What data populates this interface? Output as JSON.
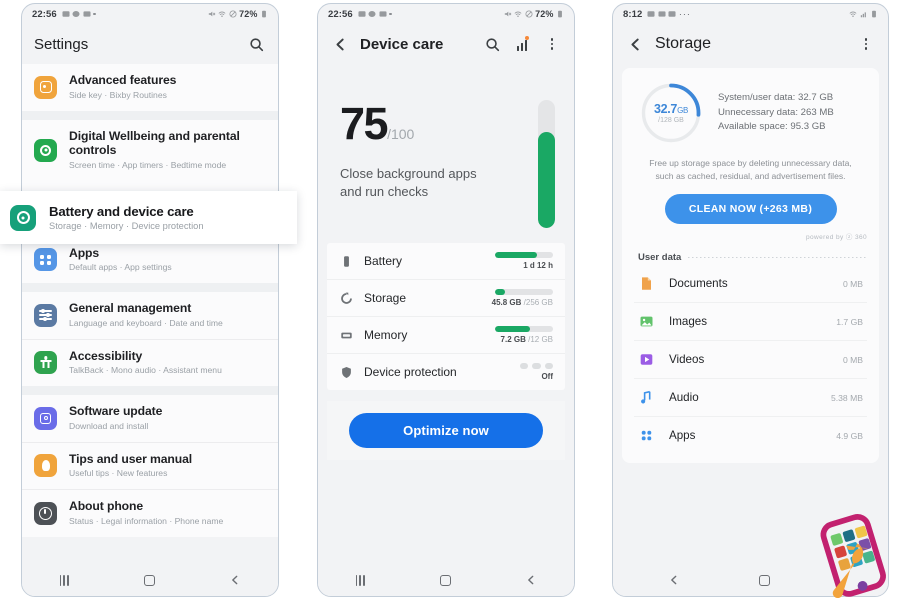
{
  "phone1": {
    "statusbar": {
      "time": "22:56",
      "battery_percent": "72%"
    },
    "appbar": {
      "title": "Settings",
      "search_icon": "search-icon"
    },
    "items": [
      {
        "title": "Advanced features",
        "subtitle": "Side key  ·  Bixby Routines",
        "icon": "advanced-features-icon",
        "color": "#f0a43c"
      },
      {
        "title": "Digital Wellbeing and parental controls",
        "subtitle": "Screen time  ·  App timers  ·  Bedtime mode",
        "icon": "digital-wellbeing-icon",
        "color": "#23a94f"
      },
      {
        "title": "Apps",
        "subtitle": "Default apps  ·  App settings",
        "icon": "apps-icon",
        "color": "#5596e6"
      },
      {
        "title": "General management",
        "subtitle": "Language and keyboard  ·  Date and time",
        "icon": "general-management-icon",
        "color": "#5b7aa3"
      },
      {
        "title": "Accessibility",
        "subtitle": "TalkBack  ·  Mono audio  ·  Assistant menu",
        "icon": "accessibility-icon",
        "color": "#2fa34f"
      },
      {
        "title": "Software update",
        "subtitle": "Download and install",
        "icon": "software-update-icon",
        "color": "#6a6ce8"
      },
      {
        "title": "Tips and user manual",
        "subtitle": "Useful tips  ·  New features",
        "icon": "tips-icon",
        "color": "#f0a43c"
      },
      {
        "title": "About phone",
        "subtitle": "Status  ·  Legal information  ·  Phone name",
        "icon": "about-phone-icon",
        "color": "#4d5156"
      }
    ],
    "highlighted": {
      "title": "Battery and device care",
      "subtitle": "Storage  ·  Memory  ·  Device protection",
      "icon": "battery-device-care-icon",
      "color": "#16a07a"
    },
    "nav": {
      "recents": "recents-icon",
      "home": "home-icon",
      "back": "back-icon"
    }
  },
  "phone2": {
    "statusbar": {
      "time": "22:56",
      "battery_percent": "72%"
    },
    "appbar": {
      "title": "Device care",
      "back_icon": "back-icon",
      "search_icon": "search-icon",
      "chart_icon": "bar-chart-icon",
      "menu_icon": "overflow-menu-icon"
    },
    "hero": {
      "score": "75",
      "score_max": "/100",
      "message_line1": "Close background apps",
      "message_line2": "and run checks",
      "gauge_percent": 75,
      "gauge_color": "#1aa864"
    },
    "rows": [
      {
        "label": "Battery",
        "icon": "battery-icon",
        "bar_percent": 72,
        "value": "1 d 12 h",
        "value_total": ""
      },
      {
        "label": "Storage",
        "icon": "storage-icon",
        "bar_percent": 18,
        "value": "45.8 GB ",
        "value_total": "/256 GB"
      },
      {
        "label": "Memory",
        "icon": "memory-icon",
        "bar_percent": 60,
        "value": "7.2 GB ",
        "value_total": "/12 GB"
      },
      {
        "label": "Device protection",
        "icon": "shield-icon",
        "bar_percent": 0,
        "value": "Off",
        "value_total": ""
      }
    ],
    "cta": {
      "label": "Optimize now",
      "color": "#1570e8"
    },
    "nav": {
      "recents": "recents-icon",
      "home": "home-icon",
      "back": "back-icon"
    }
  },
  "phone3": {
    "statusbar": {
      "time": "8:12"
    },
    "appbar": {
      "title": "Storage",
      "back_icon": "back-icon",
      "menu_icon": "overflow-menu-icon"
    },
    "ring": {
      "used": "32.7",
      "unit": "GB",
      "total": "/128 GB",
      "percent": 26,
      "color": "#3d87d8"
    },
    "details": [
      "System/user data: 32.7 GB",
      "Unnecessary data: 263 MB",
      "Available space: 95.3 GB"
    ],
    "note": "Free up storage space by deleting unnecessary data, such as cached, residual, and advertisement files.",
    "clean_button": {
      "label": "CLEAN NOW (+263 MB)",
      "color": "#3d92ea"
    },
    "powered_by": "powered by  ⓩ 360",
    "user_data_label": "User data",
    "files": [
      {
        "name": "Documents",
        "size": "0 MB",
        "icon": "document-icon",
        "color": "#f0a24b"
      },
      {
        "name": "Images",
        "size": "1.7 GB",
        "icon": "image-icon",
        "color": "#62c36c"
      },
      {
        "name": "Videos",
        "size": "0 MB",
        "icon": "video-icon",
        "color": "#9b5de5"
      },
      {
        "name": "Audio",
        "size": "5.38 MB",
        "icon": "audio-icon",
        "color": "#3d92ea"
      },
      {
        "name": "Apps",
        "size": "4.9 GB",
        "icon": "apps-grid-icon",
        "color": "#3d92ea"
      }
    ],
    "nav": {
      "back": "back-icon",
      "home": "home-icon"
    },
    "decoration": "phone-wrench-logo"
  }
}
